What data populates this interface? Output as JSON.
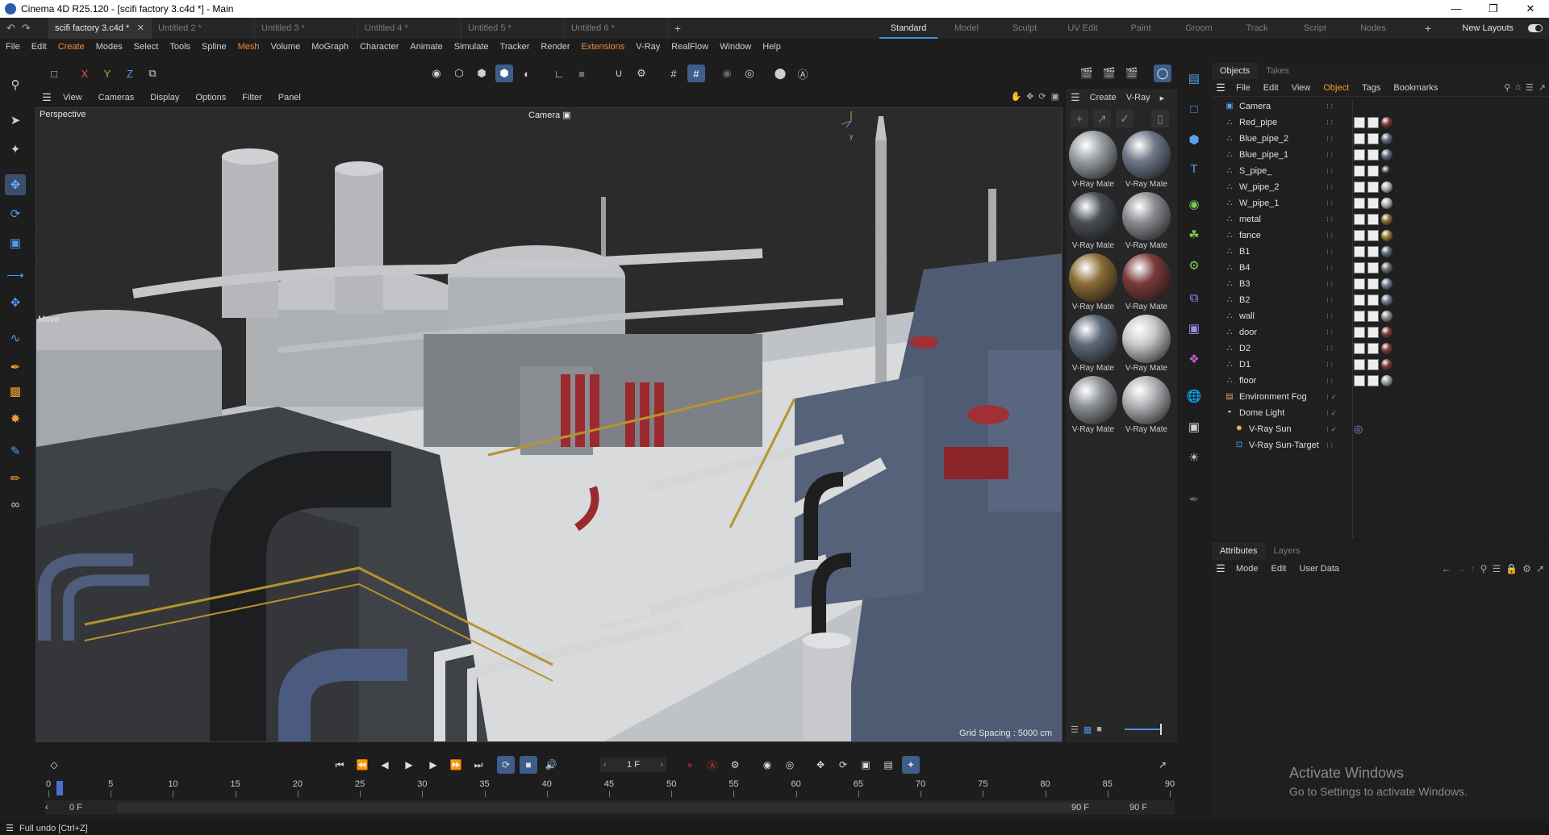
{
  "window": {
    "title": "Cinema 4D R25.120 - [scifi factory 3.c4d *] - Main",
    "controls": [
      "minimize",
      "maximize",
      "close"
    ]
  },
  "doc_tabs": [
    {
      "label": "scifi factory 3.c4d *",
      "active": true
    },
    {
      "label": "Untitled 2 *",
      "active": false
    },
    {
      "label": "Untitled 3 *",
      "active": false
    },
    {
      "label": "Untitled 4 *",
      "active": false
    },
    {
      "label": "Untitled 5 *",
      "active": false
    },
    {
      "label": "Untitled 6 *",
      "active": false
    }
  ],
  "layout_tabs": [
    "Standard",
    "Model",
    "Sculpt",
    "UV Edit",
    "Paint",
    "Groom",
    "Track",
    "Script",
    "Nodes"
  ],
  "layout_active": "Standard",
  "new_layouts_label": "New Layouts",
  "menu": [
    "File",
    "Edit",
    "Create",
    "Modes",
    "Select",
    "Tools",
    "Spline",
    "Mesh",
    "Volume",
    "MoGraph",
    "Character",
    "Animate",
    "Simulate",
    "Tracker",
    "Render",
    "Extensions",
    "V-Ray",
    "RealFlow",
    "Window",
    "Help"
  ],
  "menu_orange": [
    "Create",
    "Mesh",
    "Extensions"
  ],
  "axis_lock": {
    "x": "X",
    "y": "Y",
    "z": "Z"
  },
  "viewport": {
    "menus": [
      "View",
      "Cameras",
      "Display",
      "Options",
      "Filter",
      "Panel"
    ],
    "projection": "Perspective",
    "camera": "Camera",
    "tool": "Move",
    "grid_spacing": "Grid Spacing : 5000 cm"
  },
  "materials": {
    "menus": [
      "Create",
      "V-Ray"
    ],
    "items": [
      {
        "label": "V-Ray Mate",
        "color": "#9a9ea3"
      },
      {
        "label": "V-Ray Mate",
        "color": "#6f7888"
      },
      {
        "label": "V-Ray Mate",
        "color": "#4a4e55"
      },
      {
        "label": "V-Ray Mate",
        "color": "#8a8c90"
      },
      {
        "label": "V-Ray Mate",
        "color": "#8a6c35"
      },
      {
        "label": "V-Ray Mate",
        "color": "#7a3a3a"
      },
      {
        "label": "V-Ray Mate",
        "color": "#5d6878"
      },
      {
        "label": "V-Ray Mate",
        "color": "#c8c8c8"
      },
      {
        "label": "V-Ray Mate",
        "color": "#8e9196"
      },
      {
        "label": "V-Ray Mate",
        "color": "#b0b2b5"
      }
    ]
  },
  "objects_panel": {
    "tabs": [
      "Objects",
      "Takes"
    ],
    "menus": [
      "File",
      "Edit",
      "View",
      "Object",
      "Tags",
      "Bookmarks"
    ],
    "active_menu": "Object",
    "items": [
      {
        "name": "Camera",
        "icon": "camera-icon",
        "tags": 0
      },
      {
        "name": "Red_pipe",
        "icon": "null-object-icon",
        "tags": 3,
        "mat": "#7a3a3a"
      },
      {
        "name": "Blue_pipe_2",
        "icon": "null-object-icon",
        "tags": 3,
        "mat": "#5d6878"
      },
      {
        "name": "Blue_pipe_1",
        "icon": "null-object-icon",
        "tags": 3,
        "mat": "#5d6878"
      },
      {
        "name": "S_pipe_",
        "icon": "null-object-icon",
        "tags": 3,
        "mat": "#2a2a2a"
      },
      {
        "name": "W_pipe_2",
        "icon": "null-object-icon",
        "tags": 3,
        "mat": "#b0b2b5"
      },
      {
        "name": "W_pipe_1",
        "icon": "null-object-icon",
        "tags": 3,
        "mat": "#b0b2b5"
      },
      {
        "name": "metal",
        "icon": "null-object-icon",
        "tags": 3,
        "mat": "#8a6c35"
      },
      {
        "name": "fance",
        "icon": "null-object-icon",
        "tags": 3,
        "mat": "#9a7a30"
      },
      {
        "name": "B1",
        "icon": "null-object-icon",
        "tags": 3,
        "mat": "#5d6878"
      },
      {
        "name": "B4",
        "icon": "null-object-icon",
        "tags": 3,
        "mat": "#6a6e75"
      },
      {
        "name": "B3",
        "icon": "null-object-icon",
        "tags": 3,
        "mat": "#6f7888"
      },
      {
        "name": "B2",
        "icon": "null-object-icon",
        "tags": 3,
        "mat": "#6f7888"
      },
      {
        "name": "wall",
        "icon": "null-object-icon",
        "tags": 3,
        "mat": "#8a8c90"
      },
      {
        "name": "door",
        "icon": "null-object-icon",
        "tags": 3,
        "mat": "#7a3a3a"
      },
      {
        "name": "D2",
        "icon": "null-object-icon",
        "tags": 3,
        "mat": "#7a3a3a"
      },
      {
        "name": "D1",
        "icon": "null-object-icon",
        "tags": 3,
        "mat": "#7a3a3a"
      },
      {
        "name": "floor",
        "icon": "null-object-icon",
        "tags": 3,
        "mat": "#9a9ea3"
      },
      {
        "name": "Environment Fog",
        "icon": "fog-icon",
        "tags": 0
      },
      {
        "name": "Dome Light",
        "icon": "dome-light-icon",
        "tags": 0
      },
      {
        "name": "V-Ray Sun",
        "icon": "sun-icon",
        "tags": 1
      },
      {
        "name": "V-Ray Sun-Target",
        "icon": "target-icon",
        "tags": 0
      }
    ]
  },
  "attributes_panel": {
    "tabs": [
      "Attributes",
      "Layers"
    ],
    "menus": [
      "Mode",
      "Edit",
      "User Data"
    ]
  },
  "watermark": {
    "line1": "Activate Windows",
    "line2": "Go to Settings to activate Windows."
  },
  "timeline": {
    "current_frame": "1 F",
    "ruler_labels": [
      "0",
      "5",
      "10",
      "15",
      "20",
      "25",
      "30",
      "35",
      "40",
      "45",
      "50",
      "55",
      "60",
      "65",
      "70",
      "75",
      "80",
      "85",
      "90"
    ],
    "start_field": "0 F",
    "range_start": "0 F",
    "range_end": "90 F",
    "end_field": "90 F"
  },
  "status": {
    "message": "Full undo [Ctrl+Z]"
  }
}
